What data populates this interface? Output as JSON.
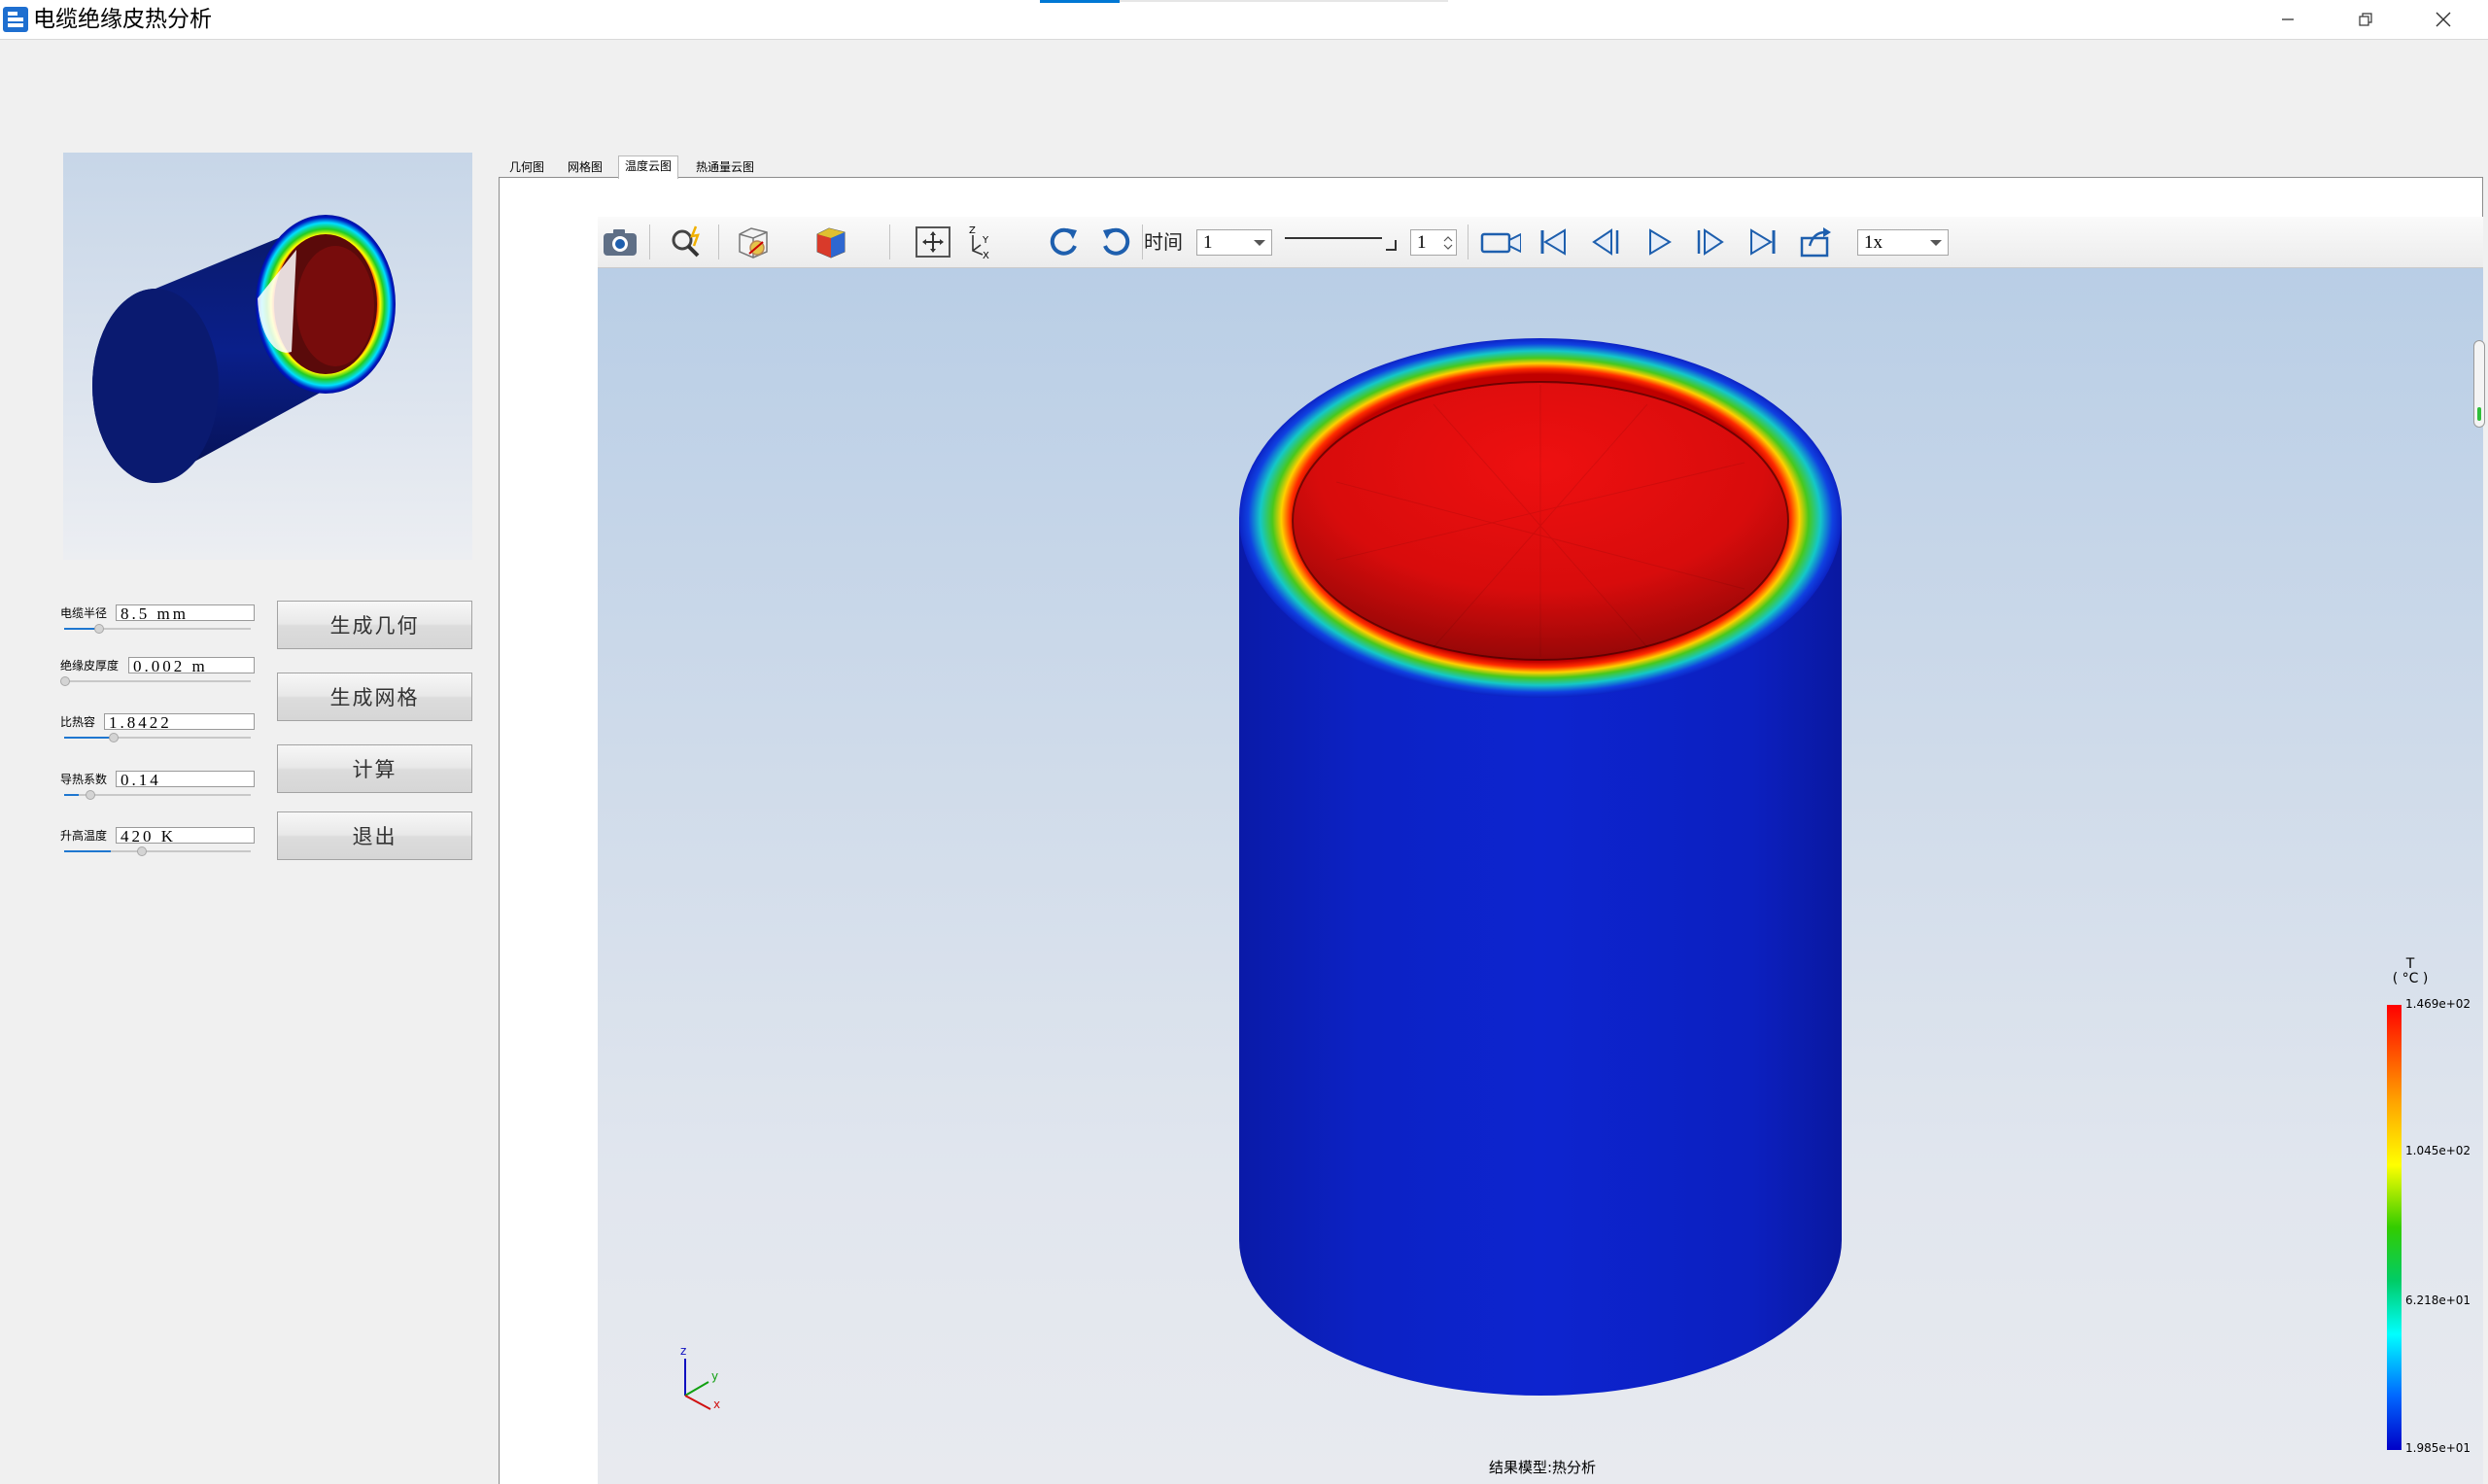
{
  "window": {
    "title": "电缆绝缘皮热分析"
  },
  "params": [
    {
      "label": "电缆半径",
      "value": "8.5 mm",
      "slider": 0.18
    },
    {
      "label": "绝缘皮厚度",
      "value": "0.002 m",
      "slider": 0.0
    },
    {
      "label": "比热容",
      "value": "1.8422",
      "slider": 0.26
    },
    {
      "label": "导热系数",
      "value": "0.14",
      "slider": 0.08
    },
    {
      "label": "升高温度",
      "value": "420 K",
      "slider": 0.25
    }
  ],
  "actions": {
    "generate_geometry": "生成几何",
    "generate_mesh": "生成网格",
    "compute": "计算",
    "exit": "退出"
  },
  "tabs": [
    "几何图",
    "网格图",
    "温度云图",
    "热通量云图"
  ],
  "active_tab": "温度云图",
  "toolbar": {
    "time_label": "时间",
    "time_value": "1",
    "step_value": "1",
    "speed_value": "1x",
    "icons": [
      "camera-icon",
      "zoom-icon",
      "display-mode-icon",
      "color-cube-icon",
      "fit-view-icon",
      "axis-icon",
      "rotate-cw-icon",
      "rotate-ccw-icon",
      "record-icon",
      "first-frame-icon",
      "prev-frame-icon",
      "play-icon",
      "next-frame-icon",
      "last-frame-icon",
      "export-icon"
    ]
  },
  "legend": {
    "title": "T",
    "unit": "( °C )",
    "labels": [
      "1.469e+02",
      "1.045e+02",
      "6.218e+01",
      "1.985e+01"
    ],
    "colors": [
      "#ff0000",
      "#ffff00",
      "#00cc44",
      "#00ffff",
      "#0000c8"
    ]
  },
  "model_label": "结果模型:热分析",
  "colors": {
    "cylinder_outer": "#0a20c8",
    "cylinder_inner": "#e01010",
    "accent": "#0078d4"
  }
}
